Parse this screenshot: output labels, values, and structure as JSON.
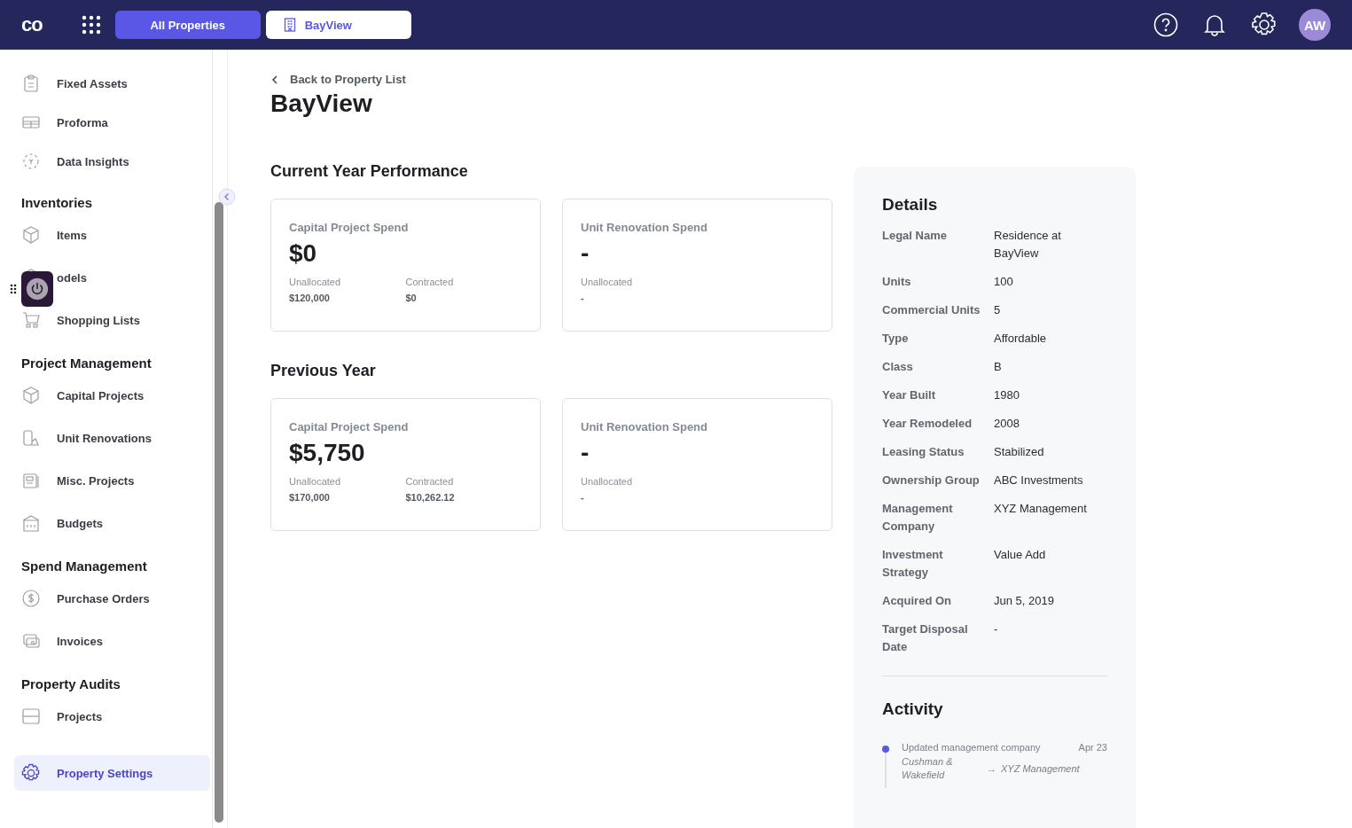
{
  "header": {
    "logo": "co",
    "tabs": [
      {
        "label": "All Properties",
        "selected": false
      },
      {
        "label": "BayView",
        "selected": true
      }
    ],
    "avatar": "AW"
  },
  "sidebar": {
    "sections": [
      {
        "items": [
          {
            "label": "Fixed Assets",
            "selected": false
          },
          {
            "label": "Proforma",
            "selected": false
          },
          {
            "label": "Data Insights",
            "selected": false
          }
        ]
      },
      {
        "title": "Inventories",
        "items": [
          {
            "label": "Items",
            "selected": false
          },
          {
            "label": "odels",
            "selected": false
          },
          {
            "label": "Shopping Lists",
            "selected": false
          }
        ]
      },
      {
        "title": "Project Management",
        "items": [
          {
            "label": "Capital Projects",
            "selected": false
          },
          {
            "label": "Unit Renovations",
            "selected": false
          },
          {
            "label": "Misc. Projects",
            "selected": false
          },
          {
            "label": "Budgets",
            "selected": false
          }
        ]
      },
      {
        "title": "Spend Management",
        "items": [
          {
            "label": "Purchase Orders",
            "selected": false
          },
          {
            "label": "Invoices",
            "selected": false
          }
        ]
      },
      {
        "title": "Property Audits",
        "items": [
          {
            "label": "Projects",
            "selected": false
          }
        ]
      }
    ],
    "footer_item": {
      "label": "Property Settings",
      "selected": true
    }
  },
  "back_link": "Back to Property List",
  "title": "BayView",
  "performance": [
    {
      "heading": "Current Year Performance",
      "cards": [
        {
          "title": "Capital Project Spend",
          "value": "$0",
          "stats": [
            {
              "label": "Unallocated",
              "value": "$120,000"
            },
            {
              "label": "Contracted",
              "value": "$0"
            }
          ]
        },
        {
          "title": "Unit Renovation Spend",
          "value": "-",
          "stats": [
            {
              "label": "Unallocated",
              "value": "-"
            }
          ]
        }
      ]
    },
    {
      "heading": "Previous Year",
      "cards": [
        {
          "title": "Capital Project Spend",
          "value": "$5,750",
          "stats": [
            {
              "label": "Unallocated",
              "value": "$170,000"
            },
            {
              "label": "Contracted",
              "value": "$10,262.12"
            }
          ]
        },
        {
          "title": "Unit Renovation Spend",
          "value": "-",
          "stats": [
            {
              "label": "Unallocated",
              "value": "-"
            }
          ]
        }
      ]
    }
  ],
  "details": {
    "title": "Details",
    "rows": [
      {
        "label": "Legal Name",
        "value": "Residence at BayView"
      },
      {
        "label": "Units",
        "value": "100"
      },
      {
        "label": "Commercial Units",
        "value": "5"
      },
      {
        "label": "Type",
        "value": "Affordable"
      },
      {
        "label": "Class",
        "value": "B"
      },
      {
        "label": "Year Built",
        "value": "1980"
      },
      {
        "label": "Year Remodeled",
        "value": "2008"
      },
      {
        "label": "Leasing Status",
        "value": "Stabilized"
      },
      {
        "label": "Ownership Group",
        "value": "ABC Investments"
      },
      {
        "label": "Management Company",
        "value": "XYZ Management"
      },
      {
        "label": "Investment Strategy",
        "value": "Value Add"
      },
      {
        "label": "Acquired On",
        "value": "Jun 5, 2019"
      },
      {
        "label": "Target Disposal Date",
        "value": "-"
      }
    ]
  },
  "activity": {
    "title": "Activity",
    "entries": [
      {
        "text": "Updated management company",
        "date": "Apr 23",
        "from": "Cushman & Wakefield",
        "arrow": "→",
        "to": "XYZ Management",
        "color": "#5b57e6"
      }
    ]
  }
}
